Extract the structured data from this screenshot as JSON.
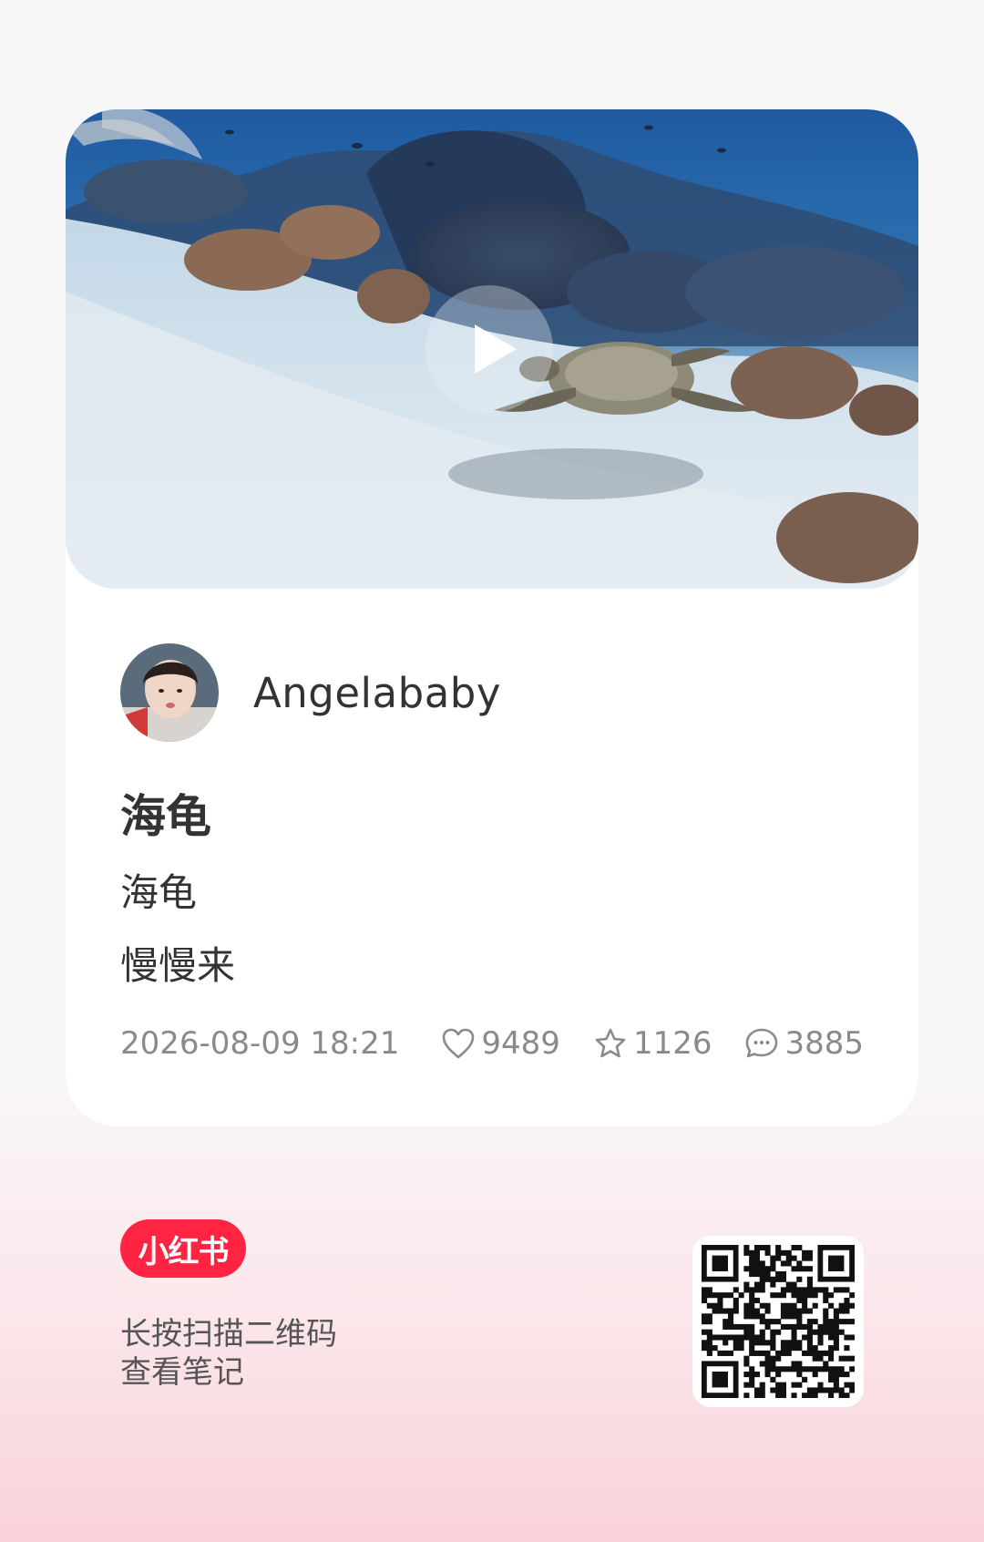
{
  "note": {
    "cover_alt": "sea turtle swimming over a coral reef",
    "author_name": "Angelababy",
    "title": "海龟",
    "body_lines": [
      "海龟",
      "慢慢来"
    ],
    "date": "2026-08-09 18:21",
    "stats": {
      "likes": "9489",
      "collects": "1126",
      "comments": "3885"
    }
  },
  "footer": {
    "logo_text": "小红书",
    "hint_line1": "长按扫描二维码",
    "hint_line2": "查看笔记"
  },
  "colors": {
    "brand_red": "#ff2442",
    "text_primary": "#333333",
    "text_secondary": "#8a8a8a"
  },
  "icons": [
    "play-icon",
    "heart-icon",
    "star-icon",
    "comment-icon",
    "qr-code"
  ]
}
